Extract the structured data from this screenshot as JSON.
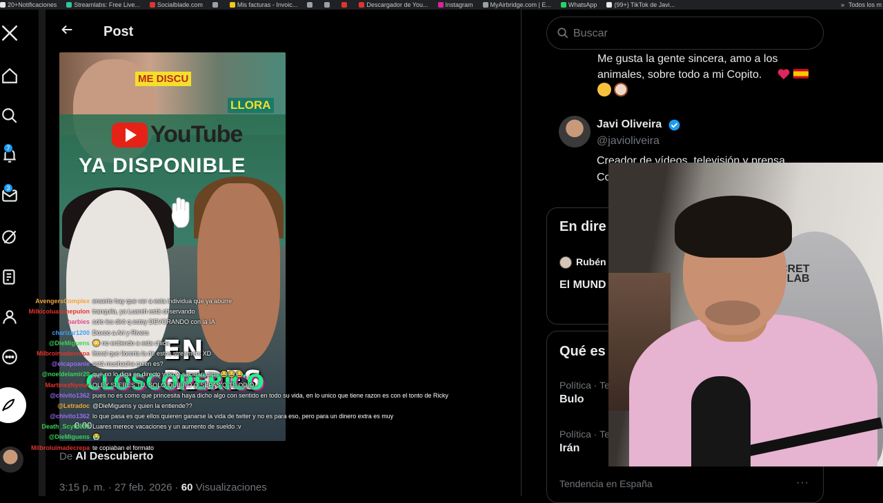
{
  "bookmarks": [
    {
      "label": "20+Notificaciones",
      "color": "#e7e9ea"
    },
    {
      "label": "Streamlabs: Free Live...",
      "color": "#31c3a2"
    },
    {
      "label": "Socialblade.com",
      "color": "#e0342e"
    },
    {
      "label": "",
      "color": "#9aa0a6"
    },
    {
      "label": "Mis facturas - Invoic...",
      "color": "#f2c81a"
    },
    {
      "label": "",
      "color": "#9aa0a6"
    },
    {
      "label": "",
      "color": "#9aa0a6"
    },
    {
      "label": "",
      "color": "#e0342e"
    },
    {
      "label": "Descargador de You...",
      "color": "#e0342e"
    },
    {
      "label": "Instagram",
      "color": "#d6249f"
    },
    {
      "label": "MyAirbridge.com | E...",
      "color": "#9aa0a6"
    },
    {
      "label": "WhatsApp",
      "color": "#25d366"
    },
    {
      "label": "(99+) TikTok de Javi...",
      "color": "#e7e9ea"
    }
  ],
  "bookmarks_more": "»",
  "bookmarks_all": "Todos los m",
  "nav": {
    "notifications_badge": "7",
    "messages_badge": "3"
  },
  "post": {
    "title": "Post",
    "thumbnail": {
      "badge_top": "ME DISCU",
      "badge_right": "LLORA",
      "youtube_word": "YouTube",
      "headline": "YA DISPONIBLE",
      "overlay_line1": "EN REDES",
      "overlay_line2": "CLOSCOPERICO"
    },
    "timecode": "0:00",
    "author_prefix": "De",
    "author": "Al Descubierto",
    "date": "3:15 p. m. · 27 feb. 2026",
    "views_count": "60",
    "views_label": "Visualizaciones"
  },
  "chat": [
    {
      "user": "AvengersComplex",
      "color": "#f2a33a",
      "text": "enserio hay que ver a esta individua que ya aburre"
    },
    {
      "user": "Milkicoluaschepulon",
      "color": "#e0342e",
      "text": "tranquila, ya Luareh está observando"
    },
    {
      "user": "barbies",
      "color": "#e04a8a",
      "text": "solo les diré q estoy DEVORANDO con la IA"
    },
    {
      "user": "charizar1200",
      "color": "#3aa0f2",
      "text": "Doxeo a Ari y Rivers"
    },
    {
      "user": "@DieMiguens",
      "color": "#3ad15a",
      "text": "😳 no entiendo a esta chica"
    },
    {
      "user": "Milbroimadecrepa",
      "color": "#e0342e",
      "text": "literal que lloreria la de estos streamers XD"
    },
    {
      "user": "@elcapoanie",
      "color": "#9a6af2",
      "text": "está muchacha quien es?"
    },
    {
      "user": "@noeldelamir20",
      "color": "#3ad15a",
      "text": "que no lo diga en directo y no le sacarán clips 😂😂😂"
    },
    {
      "user": "MartinezNymar",
      "color": "#e0342e",
      "text": "OLEY SI ERES TU, SOLO QUIERO Q SEPAS Q TE ODIO"
    },
    {
      "user": "@chivito1362",
      "color": "#9a6af2",
      "text": "pues no es como que princesita haya dicho algo con sentido en todo su vida, en lo unico que tiene razon es con el tonto de Ricky"
    },
    {
      "user": "@Letradoc",
      "color": "#f2a33a",
      "text": "@DieMiguens y quien la entiende??"
    },
    {
      "user": "@chivito1362",
      "color": "#9a6af2",
      "text": "lo que pasa es que ellos quieren ganarse la vida de twiter y no es para eso, pero para un dinero extra es muy"
    },
    {
      "user": "Death_Scythe39",
      "color": "#3ad15a",
      "text": "Luares merece vacaciones y un aumento de sueldo :v"
    },
    {
      "user": "@DieMiguens",
      "color": "#3ad15a",
      "text": "😭"
    },
    {
      "user": "Milbroluimadecrepa",
      "color": "#e0342e",
      "text": "te copiaban el formato"
    }
  ],
  "sidebar": {
    "search_placeholder": "Buscar",
    "bio_prev": "Me gusta la gente sincera, amo a los animales, sobre todo a mi Copito.",
    "suggested_user": {
      "name": "Javi Oliveira",
      "handle": "@javioliveira",
      "bio": "Creador de vídeos, televisión y prensa. Co"
    },
    "live": {
      "title": "En dire",
      "user": "Rubén",
      "text": "El MUND ALIENTO"
    },
    "trends": {
      "title": "Qué es",
      "items": [
        {
          "category": "Política · Te",
          "name": "Bulo"
        },
        {
          "category": "Política · Te",
          "name": "Irán"
        },
        {
          "category": "Tendencia en España",
          "name": ""
        }
      ],
      "more": "···"
    }
  },
  "webcam": {
    "logo_line1": "CRET",
    "logo_line2": "LAB"
  },
  "colors": {
    "accent": "#1d9bf0",
    "background": "#000000",
    "border": "#2f3336",
    "muted_text": "#71767b"
  }
}
